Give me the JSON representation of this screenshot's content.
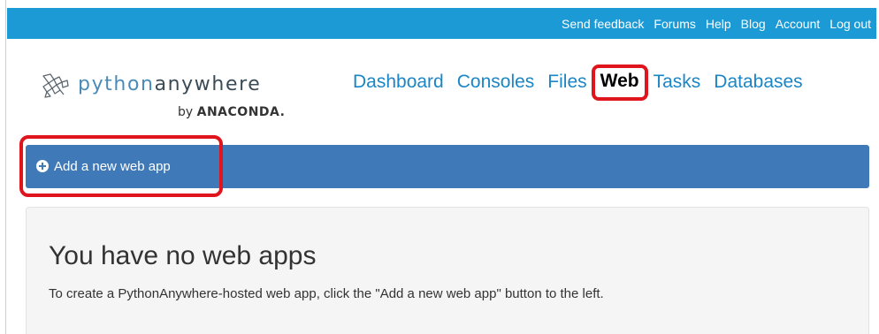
{
  "topbar": {
    "links": [
      "Send feedback",
      "Forums",
      "Help",
      "Blog",
      "Account",
      "Log out"
    ]
  },
  "logo": {
    "word_part1": "python",
    "word_part2": "anywhere",
    "by_prefix": "by",
    "by_brand": "ANACONDA."
  },
  "nav": {
    "items": [
      "Dashboard",
      "Consoles",
      "Files",
      "Web",
      "Tasks",
      "Databases"
    ],
    "active": "Web"
  },
  "actions": {
    "add_web_app_label": "Add a new web app"
  },
  "panel": {
    "title": "You have no web apps",
    "text": "To create a PythonAnywhere-hosted web app, click the \"Add a new web app\" button to the left."
  },
  "colors": {
    "topbar": "#1b9ad6",
    "nav_link": "#1b86c6",
    "action_bar": "#3f79b7",
    "highlight": "#e0141c"
  }
}
